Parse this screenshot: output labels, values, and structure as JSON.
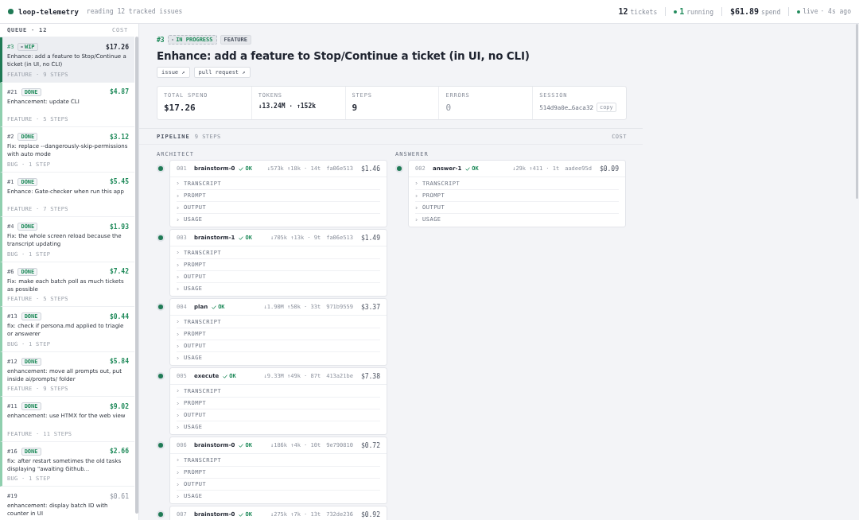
{
  "topbar": {
    "app_name": "loop-telemetry",
    "subtitle": "reading 12 tracked issues",
    "stats": [
      {
        "value": "12",
        "label": "tickets",
        "dot": false,
        "accent": false
      },
      {
        "value": "1",
        "label": "running",
        "dot": true,
        "accent": true
      },
      {
        "value": "$61.89",
        "label": "spend",
        "dot": false,
        "accent": false
      },
      {
        "value": "live",
        "label": "· 4s ago",
        "dot": true,
        "accent": false
      }
    ]
  },
  "queue": {
    "title": "QUEUE · 12",
    "cost_heading": "COST",
    "items": [
      {
        "id": "#3",
        "kind": "wip",
        "badge": "WIP",
        "cost": "$17.26",
        "title": "Enhance: add a feature to Stop/Continue a ticket (in UI, no CLI)",
        "meta": "FEATURE · 9 STEPS",
        "selected": true
      },
      {
        "id": "#21",
        "kind": "done",
        "badge": "DONE",
        "cost": "$4.87",
        "title": "Enhancement: update CLI",
        "meta": "FEATURE · 5 STEPS",
        "selected": false
      },
      {
        "id": "#2",
        "kind": "done",
        "badge": "DONE",
        "cost": "$3.12",
        "title": "Fix: replace --dangerously-skip-permissions with auto mode",
        "meta": "BUG · 1 STEP",
        "selected": false
      },
      {
        "id": "#1",
        "kind": "done",
        "badge": "DONE",
        "cost": "$5.45",
        "title": "Enhance: Gate-checker when run this app",
        "meta": "FEATURE · 7 STEPS",
        "selected": false
      },
      {
        "id": "#4",
        "kind": "done",
        "badge": "DONE",
        "cost": "$1.93",
        "title": "Fix: the whole screen reload because the transcript updating",
        "meta": "BUG · 1 STEP",
        "selected": false
      },
      {
        "id": "#6",
        "kind": "done",
        "badge": "DONE",
        "cost": "$7.42",
        "title": "Fix: make each batch poll as much tickets as possible",
        "meta": "FEATURE · 5 STEPS",
        "selected": false
      },
      {
        "id": "#13",
        "kind": "done",
        "badge": "DONE",
        "cost": "$0.44",
        "title": "fix: check if persona.md applied to triagle or answerer",
        "meta": "BUG · 1 STEP",
        "selected": false
      },
      {
        "id": "#12",
        "kind": "done",
        "badge": "DONE",
        "cost": "$5.84",
        "title": "enhancement: move all prompts out, put inside ai/prompts/ folder",
        "meta": "FEATURE · 9 STEPS",
        "selected": false
      },
      {
        "id": "#11",
        "kind": "done",
        "badge": "DONE",
        "cost": "$9.02",
        "title": "enhancement: use HTMX for the web view",
        "meta": "FEATURE · 11 STEPS",
        "selected": false
      },
      {
        "id": "#16",
        "kind": "done",
        "badge": "DONE",
        "cost": "$2.66",
        "title": "fix: after restart sometimes the old tasks displaying \"awaiting Github...",
        "meta": "BUG · 1 STEP",
        "selected": false
      },
      {
        "id": "#19",
        "kind": "queued",
        "cost": "$0.61",
        "title": "enhancement: display batch ID with counter in UI",
        "selected": false
      }
    ]
  },
  "ticket": {
    "id": "#3",
    "kind": "wip",
    "status_label": "IN PROGRESS",
    "type": "FEATURE",
    "title": "Enhance: add a feature to Stop/Continue a ticket (in UI, no CLI)",
    "links": [
      "issue ↗",
      "pull request ↗"
    ],
    "stats": [
      {
        "kind": "text",
        "label": "TOTAL SPEND",
        "value": "$17.26"
      },
      {
        "kind": "small",
        "label": "TOKENS",
        "value": "↓13.24M · ↑152k"
      },
      {
        "kind": "text",
        "label": "STEPS",
        "value": "9"
      },
      {
        "kind": "muted",
        "label": "ERRORS",
        "value": "0"
      },
      {
        "kind": "session",
        "label": "SESSION",
        "value": "514d9a0e…6aca32",
        "button": "copy"
      }
    ]
  },
  "pipeline": {
    "title": "PIPELINE",
    "count": "9 STEPS",
    "cost_heading": "COST",
    "columns": [
      {
        "title": "ARCHITECT",
        "steps": [
          {
            "num": "001",
            "name": "brainstorm-0",
            "kind": "ok",
            "status_label": "OK",
            "tokens": "↓573k ↑18k · 14t",
            "hash": "fa06e513",
            "cost": "$1.46",
            "sections": [
              "TRANSCRIPT",
              "PROMPT",
              "OUTPUT",
              "USAGE"
            ]
          },
          {
            "num": "003",
            "name": "brainstorm-1",
            "kind": "ok",
            "status_label": "OK",
            "tokens": "↓705k ↑13k · 9t",
            "hash": "fa06e513",
            "cost": "$1.49",
            "sections": [
              "TRANSCRIPT",
              "PROMPT",
              "OUTPUT",
              "USAGE"
            ]
          },
          {
            "num": "004",
            "name": "plan",
            "kind": "ok",
            "status_label": "OK",
            "tokens": "↓1.90M ↑50k · 33t",
            "hash": "971b9559",
            "cost": "$3.37",
            "sections": [
              "TRANSCRIPT",
              "PROMPT",
              "OUTPUT",
              "USAGE"
            ]
          },
          {
            "num": "005",
            "name": "execute",
            "kind": "ok",
            "status_label": "OK",
            "tokens": "↓9.33M ↑49k · 87t",
            "hash": "413a21be",
            "cost": "$7.38",
            "sections": [
              "TRANSCRIPT",
              "PROMPT",
              "OUTPUT",
              "USAGE"
            ]
          },
          {
            "num": "006",
            "name": "brainstorm-0",
            "kind": "ok",
            "status_label": "OK",
            "tokens": "↓186k ↑4k · 10t",
            "hash": "9e790810",
            "cost": "$0.72",
            "sections": [
              "TRANSCRIPT",
              "PROMPT",
              "OUTPUT",
              "USAGE"
            ]
          },
          {
            "num": "007",
            "name": "brainstorm-0",
            "kind": "ok",
            "status_label": "OK",
            "tokens": "↓275k ↑7k · 13t",
            "hash": "732de236",
            "cost": "$0.92"
          }
        ]
      },
      {
        "title": "ANSWERER",
        "steps": [
          {
            "num": "002",
            "name": "answer-1",
            "kind": "ok",
            "status_label": "OK",
            "tokens": "↓29k ↑411 · 1t",
            "hash": "aadee95d",
            "cost": "$0.09",
            "sections": [
              "TRANSCRIPT",
              "PROMPT",
              "OUTPUT",
              "USAGE"
            ]
          }
        ]
      }
    ]
  }
}
